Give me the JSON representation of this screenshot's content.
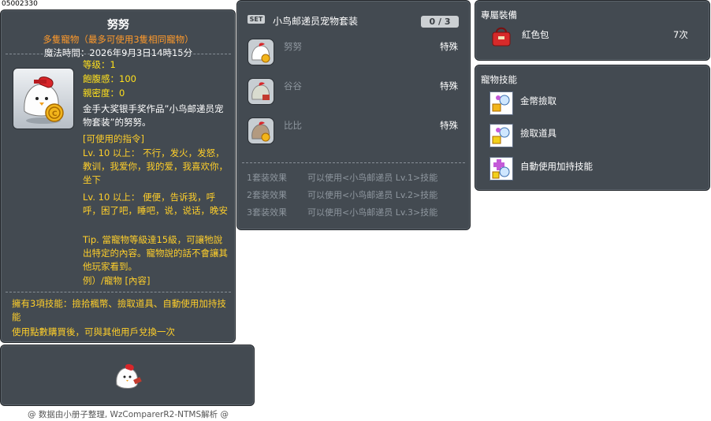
{
  "item": {
    "id": "05002330",
    "name": "努努",
    "tag": "多隻寵物（最多可使用3隻相同寵物）",
    "magic_time": "魔法時間：2026年9月3日14時15分",
    "stats": {
      "level": "等级：1",
      "fullness": "飽腹感：100",
      "closeness": "親密度：0"
    },
    "description": "金手大奖银手奖作品”小鸟邮递员宠物套装”的努努。",
    "commands_header": "[可使用的指令]",
    "commands_lv10_a": "Lv. 10 以上： 不行，发火，发怒，教训，我爱你，我的爱，我喜欢你，坐下",
    "commands_lv10_b": "Lv. 10 以上： 便便，告诉我，呼呼，困了吧，睡吧，说，说话，晚安",
    "tip": "Tip. 當寵物等級達15級，可讓牠說出特定的內容。寵物說的話不會讓其他玩家看到。",
    "example": "例）/寵物 [內容]",
    "skills_summary": "擁有3項技能：撿拾楓幣、撿取道具、自動使用加持技能",
    "trade_note": "使用點數購買後，可與其他用戶兌換一次"
  },
  "set": {
    "badge": "SET",
    "name": "小鸟邮递员宠物套装",
    "count": "0 / 3",
    "members": [
      {
        "name": "努努",
        "type": "特殊"
      },
      {
        "name": "谷谷",
        "type": "特殊"
      },
      {
        "name": "比比",
        "type": "特殊"
      }
    ],
    "effects": [
      {
        "label": "1套装效果",
        "text": "可以使用<小鸟邮递员 Lv.1>技能"
      },
      {
        "label": "2套装效果",
        "text": "可以使用<小鸟邮递员 Lv.2>技能"
      },
      {
        "label": "3套装效果",
        "text": "可以使用<小鸟邮递员 Lv.3>技能"
      }
    ]
  },
  "equip": {
    "header": "專屬裝備",
    "name": "紅色包",
    "qty": "7次"
  },
  "pet_skills": {
    "header": "寵物技能",
    "items": [
      "金幣撿取",
      "撿取道具",
      "自動使用加持技能"
    ]
  },
  "footer": "@ 数据由小册子整理, WzComparerR2-NTMS解析 @",
  "colors": {
    "panel": "#434a51",
    "orange": "#ff9a2b",
    "yellow": "#ffcf2a"
  }
}
